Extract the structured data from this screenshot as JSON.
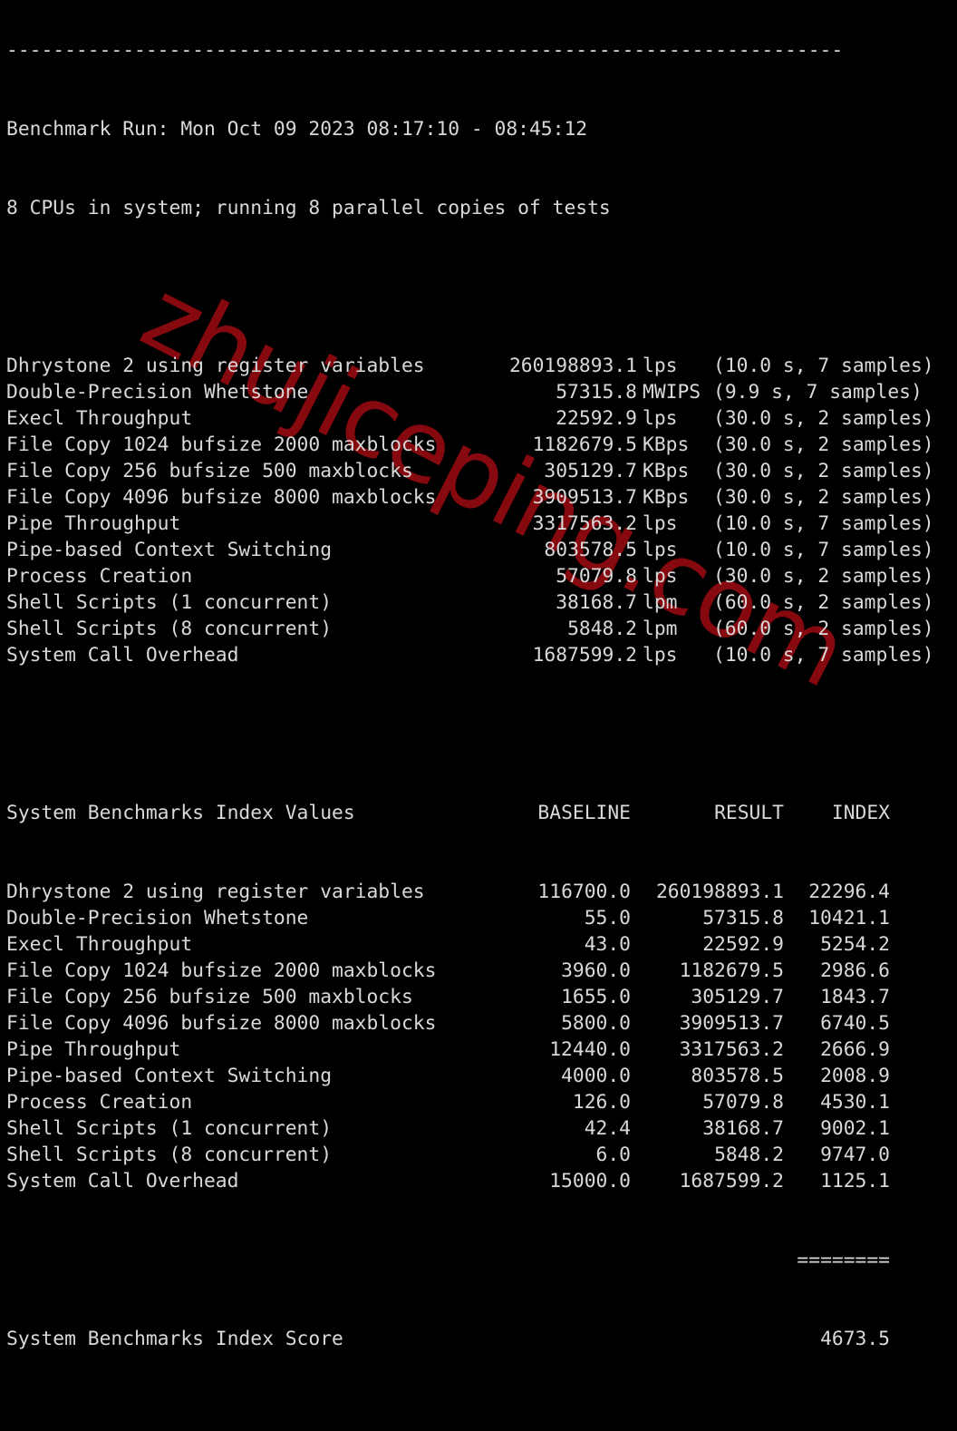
{
  "terminal": {
    "separator": "------------------------------------------------------------------------",
    "run_header": "Benchmark Run: Mon Oct 09 2023 08:17:10 - 08:45:12",
    "cpu_line": "8 CPUs in system; running 8 parallel copies of tests",
    "results": [
      {
        "name": "Dhrystone 2 using register variables",
        "value": "260198893.1",
        "unit": "lps",
        "detail": "(10.0 s, 7 samples)"
      },
      {
        "name": "Double-Precision Whetstone",
        "value": "57315.8",
        "unit": "MWIPS",
        "detail": "(9.9 s, 7 samples)"
      },
      {
        "name": "Execl Throughput",
        "value": "22592.9",
        "unit": "lps",
        "detail": "(30.0 s, 2 samples)"
      },
      {
        "name": "File Copy 1024 bufsize 2000 maxblocks",
        "value": "1182679.5",
        "unit": "KBps",
        "detail": "(30.0 s, 2 samples)"
      },
      {
        "name": "File Copy 256 bufsize 500 maxblocks",
        "value": "305129.7",
        "unit": "KBps",
        "detail": "(30.0 s, 2 samples)"
      },
      {
        "name": "File Copy 4096 bufsize 8000 maxblocks",
        "value": "3909513.7",
        "unit": "KBps",
        "detail": "(30.0 s, 2 samples)"
      },
      {
        "name": "Pipe Throughput",
        "value": "3317563.2",
        "unit": "lps",
        "detail": "(10.0 s, 7 samples)"
      },
      {
        "name": "Pipe-based Context Switching",
        "value": "803578.5",
        "unit": "lps",
        "detail": "(10.0 s, 7 samples)"
      },
      {
        "name": "Process Creation",
        "value": "57079.8",
        "unit": "lps",
        "detail": "(30.0 s, 2 samples)"
      },
      {
        "name": "Shell Scripts (1 concurrent)",
        "value": "38168.7",
        "unit": "lpm",
        "detail": "(60.0 s, 2 samples)"
      },
      {
        "name": "Shell Scripts (8 concurrent)",
        "value": "5848.2",
        "unit": "lpm",
        "detail": "(60.0 s, 2 samples)"
      },
      {
        "name": "System Call Overhead",
        "value": "1687599.2",
        "unit": "lps",
        "detail": "(10.0 s, 7 samples)"
      }
    ],
    "index_table": {
      "title": "System Benchmarks Index Values",
      "headers": {
        "baseline": "BASELINE",
        "result": "RESULT",
        "index": "INDEX"
      },
      "rows": [
        {
          "name": "Dhrystone 2 using register variables",
          "baseline": "116700.0",
          "result": "260198893.1",
          "index": "22296.4"
        },
        {
          "name": "Double-Precision Whetstone",
          "baseline": "55.0",
          "result": "57315.8",
          "index": "10421.1"
        },
        {
          "name": "Execl Throughput",
          "baseline": "43.0",
          "result": "22592.9",
          "index": "5254.2"
        },
        {
          "name": "File Copy 1024 bufsize 2000 maxblocks",
          "baseline": "3960.0",
          "result": "1182679.5",
          "index": "2986.6"
        },
        {
          "name": "File Copy 256 bufsize 500 maxblocks",
          "baseline": "1655.0",
          "result": "305129.7",
          "index": "1843.7"
        },
        {
          "name": "File Copy 4096 bufsize 8000 maxblocks",
          "baseline": "5800.0",
          "result": "3909513.7",
          "index": "6740.5"
        },
        {
          "name": "Pipe Throughput",
          "baseline": "12440.0",
          "result": "3317563.2",
          "index": "2666.9"
        },
        {
          "name": "Pipe-based Context Switching",
          "baseline": "4000.0",
          "result": "803578.5",
          "index": "2008.9"
        },
        {
          "name": "Process Creation",
          "baseline": "126.0",
          "result": "57079.8",
          "index": "4530.1"
        },
        {
          "name": "Shell Scripts (1 concurrent)",
          "baseline": "42.4",
          "result": "38168.7",
          "index": "9002.1"
        },
        {
          "name": "Shell Scripts (8 concurrent)",
          "baseline": "6.0",
          "result": "5848.2",
          "index": "9747.0"
        },
        {
          "name": "System Call Overhead",
          "baseline": "15000.0",
          "result": "1687599.2",
          "index": "1125.1"
        }
      ],
      "total_rule": "========",
      "score_label": "System Benchmarks Index Score",
      "score_value": "4673.5"
    }
  },
  "watermark": {
    "text": "zhujiceping.com",
    "color": "#8e0a10"
  }
}
